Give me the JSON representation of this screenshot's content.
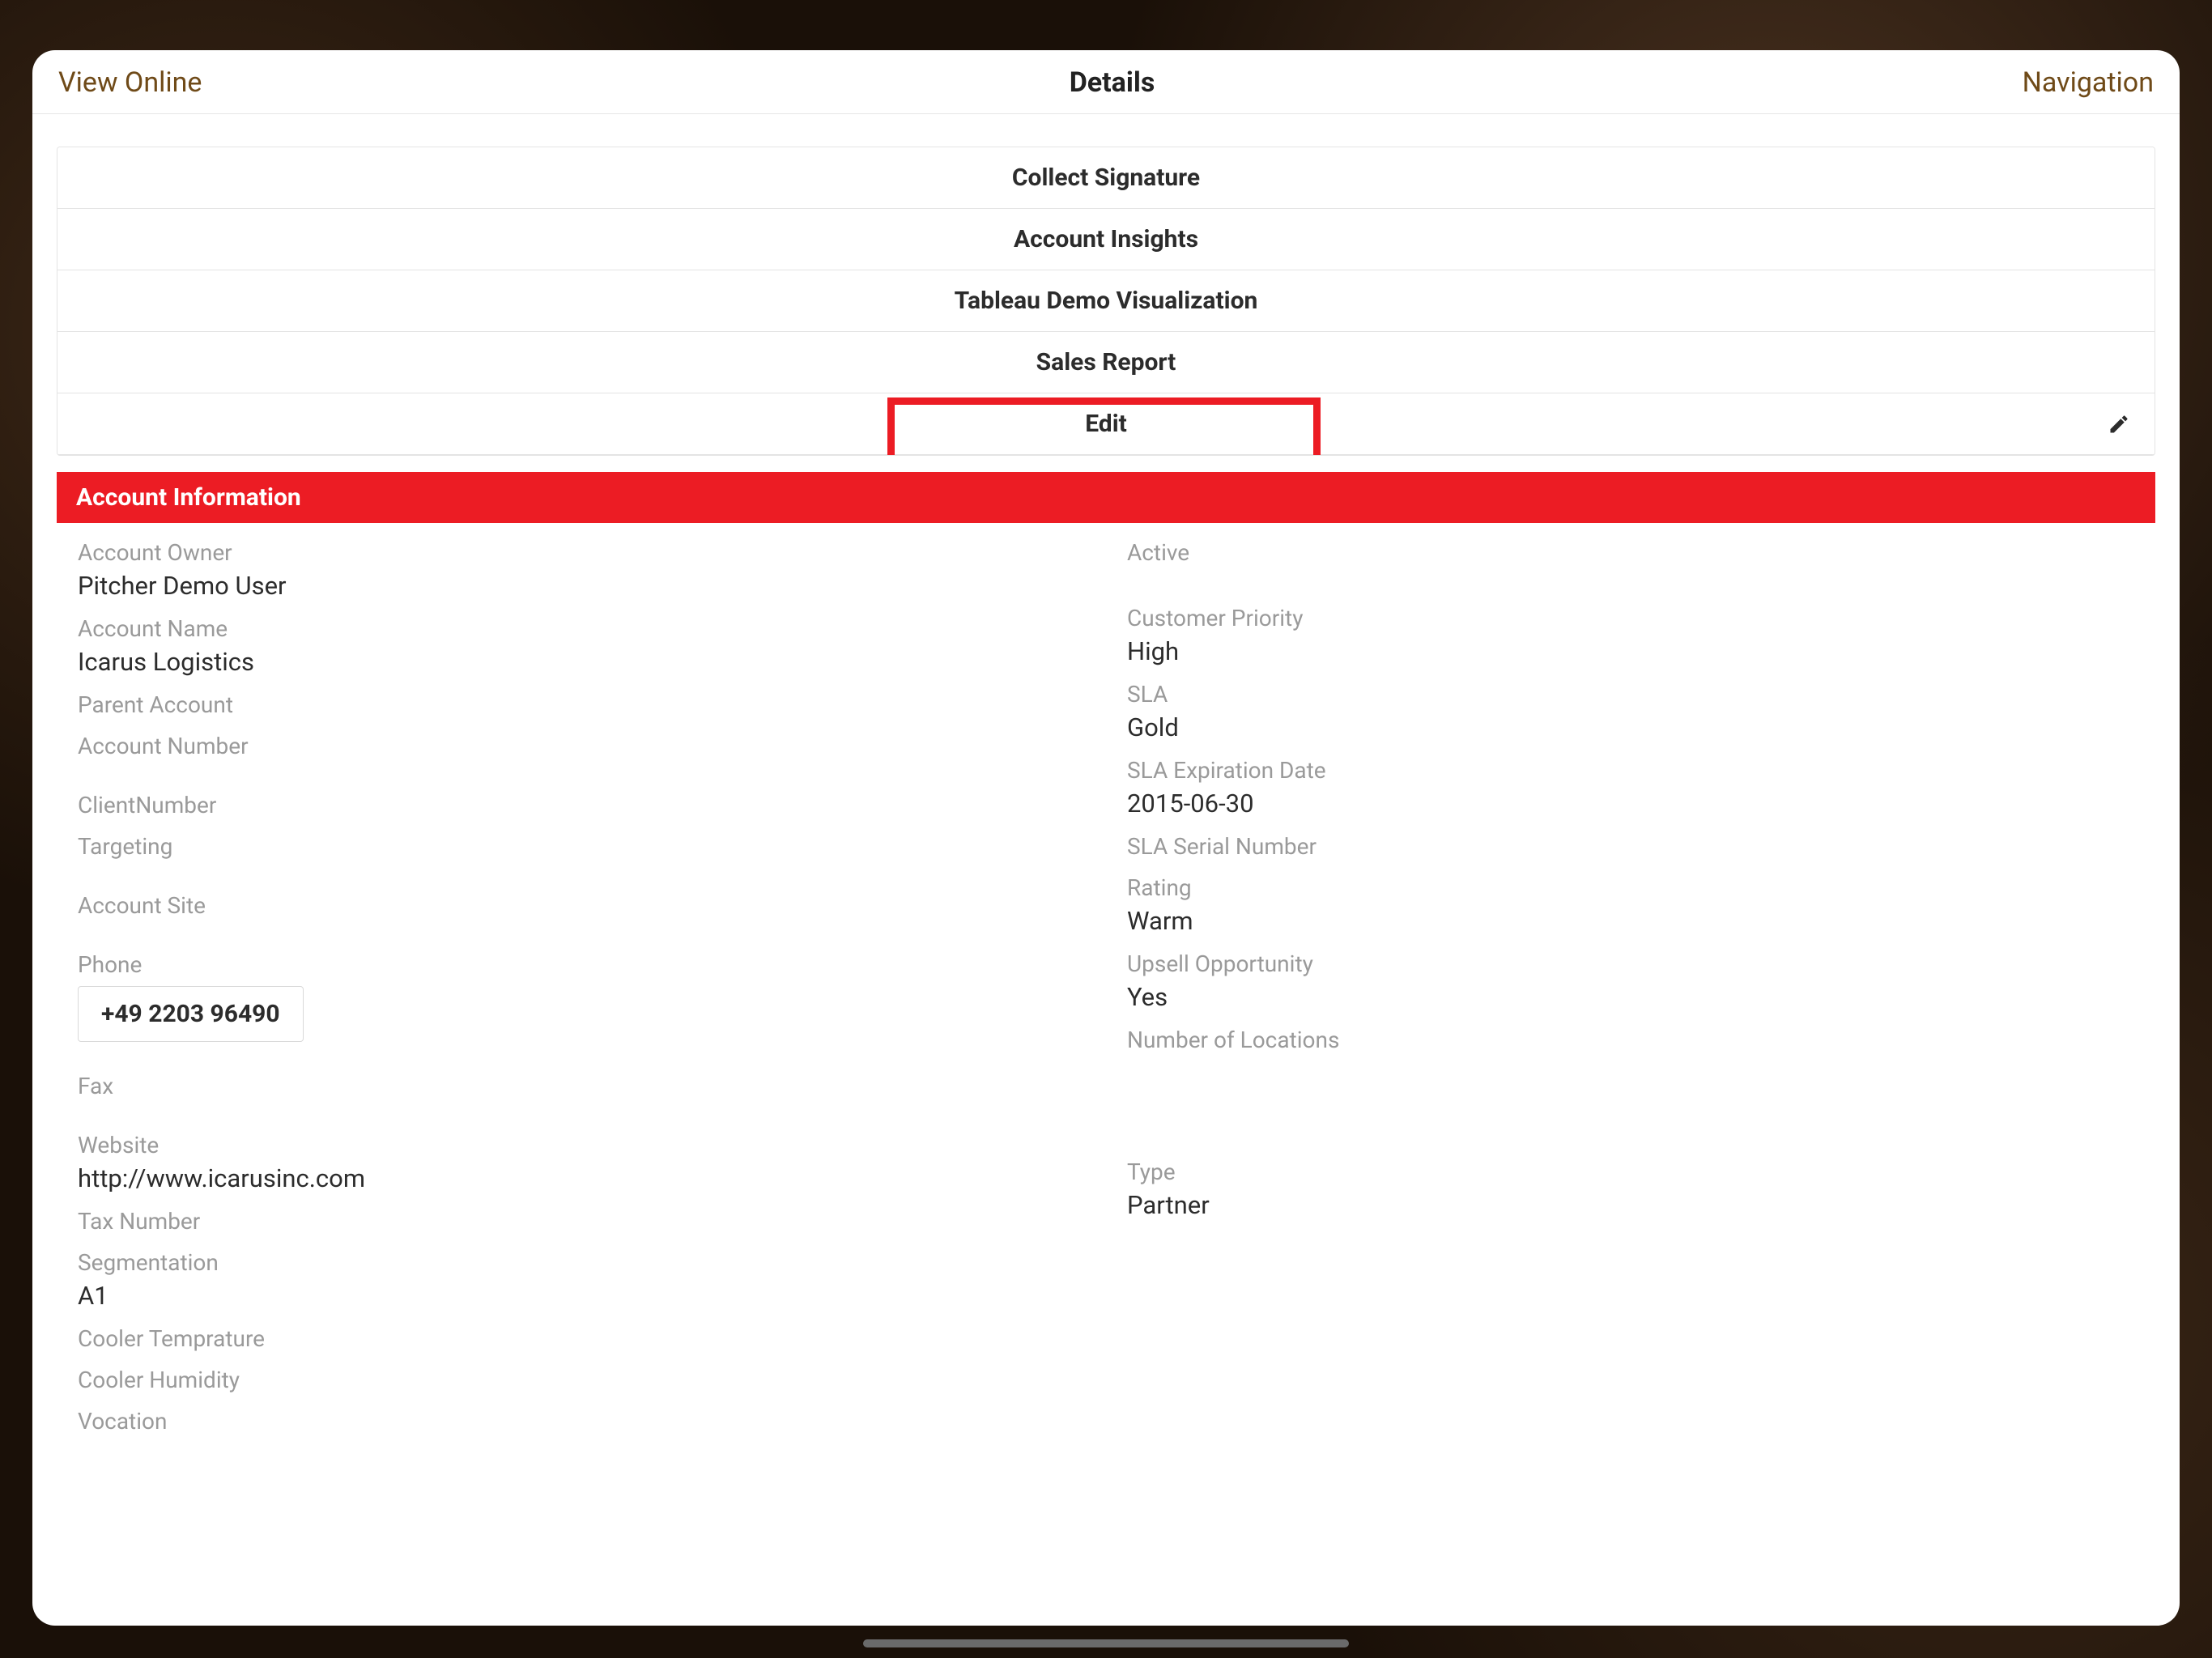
{
  "header": {
    "left": "View Online",
    "title": "Details",
    "right": "Navigation"
  },
  "actions": {
    "collect_signature": "Collect Signature",
    "account_insights": "Account Insights",
    "tableau_demo": "Tableau Demo Visualization",
    "sales_report": "Sales Report",
    "edit": "Edit"
  },
  "section": {
    "title": "Account Information"
  },
  "left_fields": {
    "account_owner_label": "Account Owner",
    "account_owner_value": "Pitcher Demo User",
    "account_name_label": "Account Name",
    "account_name_value": "Icarus Logistics",
    "parent_account_label": "Parent Account",
    "parent_account_value": "",
    "account_number_label": "Account Number",
    "account_number_value": "",
    "client_number_label": "ClientNumber",
    "client_number_value": "",
    "targeting_label": "Targeting",
    "targeting_value": "",
    "account_site_label": "Account Site",
    "account_site_value": "",
    "phone_label": "Phone",
    "phone_value": "+49 2203 96490",
    "fax_label": "Fax",
    "fax_value": "",
    "website_label": "Website",
    "website_value": "http://www.icarusinc.com",
    "tax_number_label": "Tax Number",
    "tax_number_value": "",
    "segmentation_label": "Segmentation",
    "segmentation_value": "A1",
    "cooler_temp_label": "Cooler Temprature",
    "cooler_temp_value": "",
    "cooler_humidity_label": "Cooler Humidity",
    "cooler_humidity_value": "",
    "vocation_label": "Vocation",
    "vocation_value": ""
  },
  "right_fields": {
    "active_label": "Active",
    "active_value": "",
    "customer_priority_label": "Customer Priority",
    "customer_priority_value": "High",
    "sla_label": "SLA",
    "sla_value": "Gold",
    "sla_exp_label": "SLA Expiration Date",
    "sla_exp_value": "2015-06-30",
    "sla_serial_label": "SLA Serial Number",
    "sla_serial_value": "",
    "rating_label": "Rating",
    "rating_value": "Warm",
    "upsell_label": "Upsell Opportunity",
    "upsell_value": "Yes",
    "locations_label": "Number of Locations",
    "locations_value": "",
    "type_label": "Type",
    "type_value": "Partner"
  }
}
